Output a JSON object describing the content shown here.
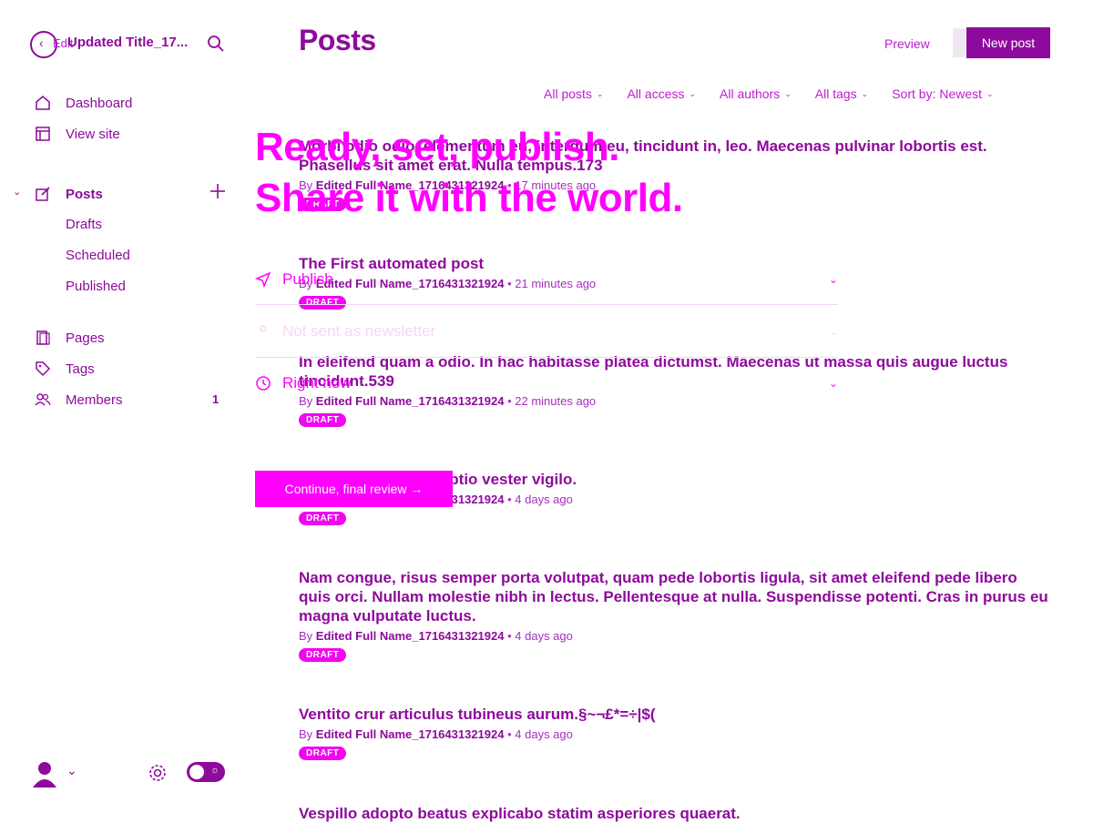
{
  "sidebar": {
    "back_label": "Edit",
    "site_title": "Updated Title_17...",
    "items": [
      {
        "label": "Dashboard"
      },
      {
        "label": "View site"
      },
      {
        "label": "Posts"
      },
      {
        "label": "Drafts"
      },
      {
        "label": "Scheduled"
      },
      {
        "label": "Published"
      },
      {
        "label": "Pages"
      },
      {
        "label": "Tags"
      },
      {
        "label": "Members",
        "count": "1"
      }
    ]
  },
  "header": {
    "title": "Posts",
    "preview_label": "Preview",
    "new_post_label": "New post"
  },
  "filters": [
    {
      "label": "All posts"
    },
    {
      "label": "All access"
    },
    {
      "label": "All authors"
    },
    {
      "label": "All tags"
    },
    {
      "label": "Sort by: Newest"
    }
  ],
  "posts": [
    {
      "title": "Morbi odio odio, elementum eu, interdum eu, tincidunt in, leo. Maecenas pulvinar lobortis est. Phasellus sit amet erat. Nulla tempus.173",
      "author": "Edited Full Name_1716431321924",
      "time": "17 minutes ago",
      "status": "DRAFT"
    },
    {
      "title": "The First automated post",
      "author": "Edited Full Name_1716431321924",
      "time": "21 minutes ago",
      "status": "DRAFT"
    },
    {
      "title": "In eleifend quam a odio. In hac habitasse platea dictumst. Maecenas ut massa quis augue luctus tincidunt.539",
      "author": "Edited Full Name_1716431321924",
      "time": "22 minutes ago",
      "status": "DRAFT"
    },
    {
      "title": "Suppono tyrannus optio vester vigilo.",
      "author": "Edited Full Name_1716431321924",
      "time": "4 days ago",
      "status": "DRAFT"
    },
    {
      "title": "Nam congue, risus semper porta volutpat, quam pede lobortis ligula, sit amet eleifend pede libero quis orci. Nullam molestie nibh in lectus. Pellentesque at nulla. Suspendisse potenti. Cras in purus eu magna vulputate luctus.",
      "author": "Edited Full Name_1716431321924",
      "time": "4 days ago",
      "status": "DRAFT"
    },
    {
      "title": "Ventito crur articulus tubineus aurum.§~¬£*=÷|$(",
      "author": "Edited Full Name_1716431321924",
      "time": "4 days ago",
      "status": "DRAFT"
    },
    {
      "title": "Vespillo adopto beatus explicabo statim asperiores quaerat.",
      "author": "",
      "time": "",
      "status": ""
    }
  ],
  "publish_flow": {
    "headline_1": "Ready, set, publish.",
    "headline_2": "Share it with the world.",
    "rows": [
      {
        "label": "Publish"
      },
      {
        "label": "Not sent as newsletter"
      },
      {
        "label": "Right now"
      }
    ],
    "continue_label": "Continue, final review →"
  },
  "colors": {
    "primary": "#8e0a9c",
    "accent": "#ff00ff",
    "badge": "#f007f0"
  }
}
